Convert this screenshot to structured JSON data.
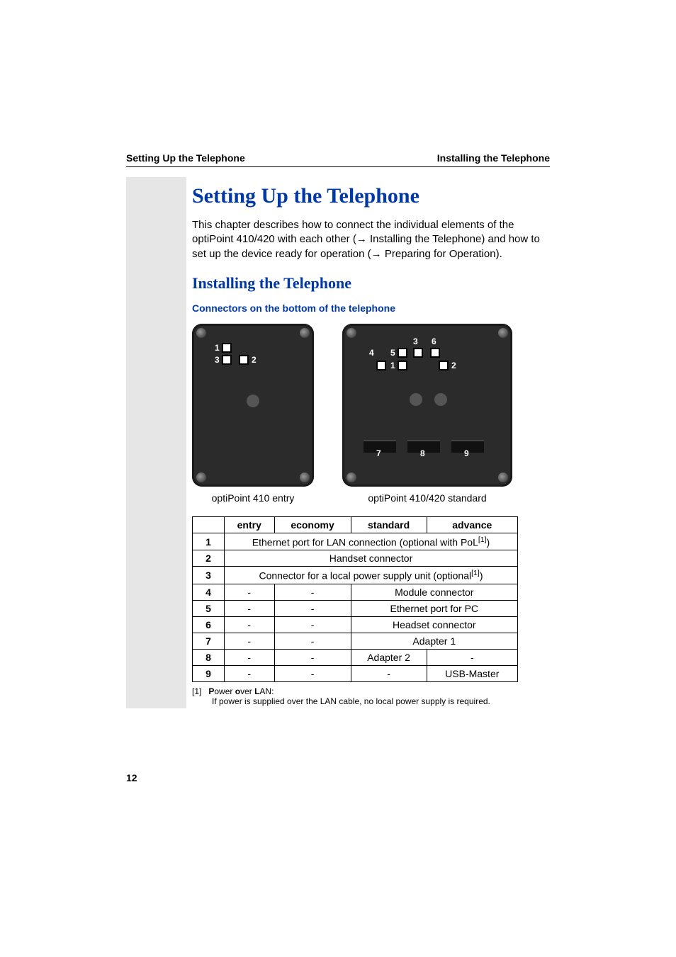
{
  "header": {
    "left": "Setting Up the Telephone",
    "right": "Installing the Telephone"
  },
  "h1": "Setting Up the Telephone",
  "intro_parts": {
    "p1a": "This chapter describes how to connect the individual elements of the optiPoint 410/420 with each other (",
    "arrow1": "→",
    "p1b": " Installing the Telephone) and how to set up the device ready for operation (",
    "arrow2": "→",
    "p1c": " Preparing for Operation)."
  },
  "h2": "Installing the Telephone",
  "h3": "Connectors on the bottom of the telephone",
  "fig": {
    "entry_caption": "optiPoint 410 entry",
    "std_caption": "optiPoint 410/420 standard",
    "entry_labels": {
      "n1": "1",
      "n2": "2",
      "n3": "3"
    },
    "std_labels": {
      "n1": "1",
      "n2": "2",
      "n3": "3",
      "n4": "4",
      "n5": "5",
      "n6": "6",
      "n7": "7",
      "n8": "8",
      "n9": "9"
    }
  },
  "table": {
    "headers": {
      "blank": "",
      "entry": "entry",
      "economy": "economy",
      "standard": "standard",
      "advance": "advance"
    },
    "rows": [
      {
        "n": "1",
        "span4": "Ethernet port for LAN connection (optional with PoL",
        "sup": "[1]",
        "span4_tail": ")"
      },
      {
        "n": "2",
        "span4": "Handset connector"
      },
      {
        "n": "3",
        "span4": "Connector for a local power supply unit (optional",
        "sup": "[1]",
        "span4_tail": ")"
      },
      {
        "n": "4",
        "entry": "-",
        "economy": "-",
        "std_adv_span": "Module connector"
      },
      {
        "n": "5",
        "entry": "-",
        "economy": "-",
        "std_adv_span": "Ethernet port for PC"
      },
      {
        "n": "6",
        "entry": "-",
        "economy": "-",
        "std_adv_span": "Headset connector"
      },
      {
        "n": "7",
        "entry": "-",
        "economy": "-",
        "std_adv_span": "Adapter 1"
      },
      {
        "n": "8",
        "entry": "-",
        "economy": "-",
        "standard": "Adapter 2",
        "advance": "-"
      },
      {
        "n": "9",
        "entry": "-",
        "economy": "-",
        "standard": "-",
        "advance": "USB-Master"
      }
    ]
  },
  "footnote": {
    "ref": "[1]",
    "line1_parts": {
      "a": "P",
      "b": "ower ",
      "c": "o",
      "d": "ver ",
      "e": "L",
      "f": "AN:"
    },
    "line2": "If power is supplied over the LAN cable, no local power supply is required."
  },
  "page_number": "12"
}
